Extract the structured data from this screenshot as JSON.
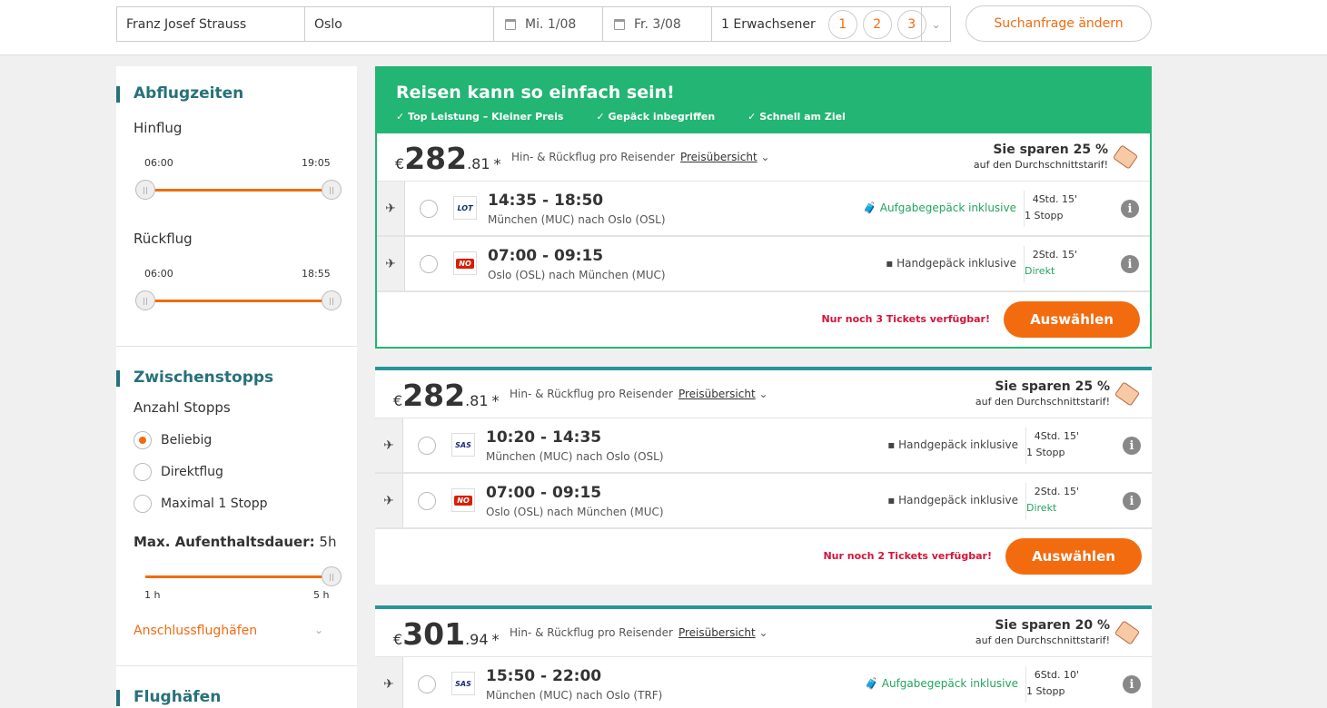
{
  "search": {
    "from": "Franz Josef Strauss",
    "to": "Oslo",
    "depart": "Mi. 1/08",
    "return": "Fr. 3/08",
    "passengers": "1 Erwachsener",
    "pax_options": [
      "1",
      "2",
      "3"
    ],
    "change_label": "Suchanfrage ändern"
  },
  "sidebar": {
    "departure_times": {
      "heading": "Abflugzeiten",
      "outbound_label": "Hinflug",
      "outbound_min": "06:00",
      "outbound_max": "19:05",
      "return_label": "Rückflug",
      "return_min": "06:00",
      "return_max": "18:55"
    },
    "stops": {
      "heading": "Zwischenstopps",
      "count_label": "Anzahl Stopps",
      "options": [
        "Beliebig",
        "Direktflug",
        "Maximal 1 Stopp"
      ],
      "selected": "Beliebig",
      "max_stay_label": "Max. Aufenthaltsdauer:",
      "max_stay_value": "5h",
      "range_min": "1 h",
      "range_max": "5 h",
      "connecting_link": "Anschlussflughäfen"
    },
    "airports_heading": "Flughäfen"
  },
  "featured": {
    "title": "Reisen kann so einfach sein!",
    "perks": [
      "Top Leistung – Kleiner Preis",
      "Gepäck inbegriffen",
      "Schnell am Ziel"
    ]
  },
  "common": {
    "price_note": "Hin- & Rückflug pro Reisender",
    "price_link": "Preisübersicht",
    "save_sub": "auf den Durchschnittstarif!",
    "choose_label": "Auswählen",
    "currency": "€",
    "star": "*"
  },
  "results": [
    {
      "price_main": "282",
      "price_cents": ".81",
      "save": "Sie sparen 25 %",
      "legs": [
        {
          "times": "14:35 - 18:50",
          "route": "München (MUC) nach Oslo (OSL)",
          "airline": "LOT",
          "baggage": "Aufgabegepäck inklusive",
          "duration": "4Std. 15'",
          "stops": "1 Stopp"
        },
        {
          "times": "07:00 - 09:15",
          "route": "Oslo (OSL) nach München (MUC)",
          "airline": "NOR",
          "baggage": "Handgepäck inklusive",
          "duration": "2Std. 15'",
          "stops": "Direkt"
        }
      ],
      "availability": "Nur noch 3 Tickets verfügbar!"
    },
    {
      "price_main": "282",
      "price_cents": ".81",
      "save": "Sie sparen 25 %",
      "legs": [
        {
          "times": "10:20 - 14:35",
          "route": "München (MUC) nach Oslo (OSL)",
          "airline": "SAS",
          "baggage": "Handgepäck inklusive",
          "duration": "4Std. 15'",
          "stops": "1 Stopp"
        },
        {
          "times": "07:00 - 09:15",
          "route": "Oslo (OSL) nach München (MUC)",
          "airline": "NOR",
          "baggage": "Handgepäck inklusive",
          "duration": "2Std. 15'",
          "stops": "Direkt"
        }
      ],
      "availability": "Nur noch 2 Tickets verfügbar!"
    },
    {
      "price_main": "301",
      "price_cents": ".94",
      "save": "Sie sparen 20 %",
      "legs": [
        {
          "times": "15:50 - 22:00",
          "route": "München (MUC) nach Oslo (TRF)",
          "airline": "SAS",
          "baggage": "Aufgabegepäck inklusive",
          "duration": "6Std. 10'",
          "stops": "1 Stopp"
        }
      ]
    }
  ],
  "colors": {
    "accent": "#f26b0f",
    "teal": "#27717a",
    "green": "#22b573"
  }
}
